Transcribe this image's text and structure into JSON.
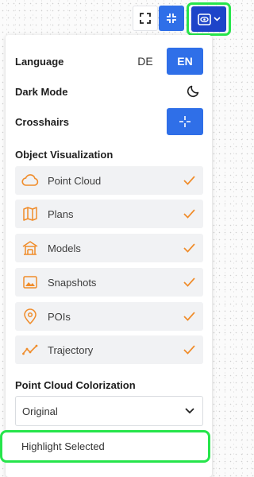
{
  "toolbar": {
    "fullscreen_icon": "expand-corners-icon",
    "collapse_icon": "collapse-corners-icon",
    "view_icon": "eye-icon",
    "view_dropdown_icon": "chevron-down-icon"
  },
  "settings": {
    "language": {
      "label": "Language",
      "options": [
        "DE",
        "EN"
      ],
      "selected": "EN"
    },
    "dark_mode": {
      "label": "Dark Mode",
      "icon": "moon-icon"
    },
    "crosshairs": {
      "label": "Crosshairs",
      "icon": "crosshair-icon",
      "enabled": true
    }
  },
  "object_visualization": {
    "title": "Object Visualization",
    "items": [
      {
        "label": "Point Cloud",
        "icon": "cloud-icon",
        "checked": true
      },
      {
        "label": "Plans",
        "icon": "map-icon",
        "checked": true
      },
      {
        "label": "Models",
        "icon": "building-icon",
        "checked": true
      },
      {
        "label": "Snapshots",
        "icon": "image-icon",
        "checked": true
      },
      {
        "label": "POIs",
        "icon": "pin-icon",
        "checked": true
      },
      {
        "label": "Trajectory",
        "icon": "trajectory-icon",
        "checked": true
      }
    ]
  },
  "colorization": {
    "title": "Point Cloud Colorization",
    "selected": "Original",
    "dropdown_options": [
      "Highlight Selected"
    ]
  },
  "colors": {
    "accent": "#2f6fe8",
    "accent_dark": "#1d44c9",
    "orange": "#f08c2a",
    "highlight_green": "#26e54b"
  }
}
